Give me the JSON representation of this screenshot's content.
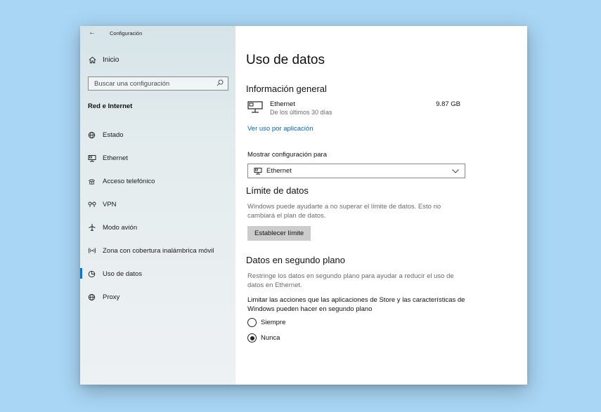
{
  "window": {
    "title": "Configuración"
  },
  "sidebar": {
    "home_label": "Inicio",
    "search_placeholder": "Buscar una configuración",
    "section_title": "Red e Internet",
    "items": [
      {
        "label": "Estado",
        "icon": "status-globe-icon"
      },
      {
        "label": "Ethernet",
        "icon": "ethernet-icon"
      },
      {
        "label": "Acceso telefónico",
        "icon": "dial-up-icon"
      },
      {
        "label": "VPN",
        "icon": "vpn-icon"
      },
      {
        "label": "Modo avión",
        "icon": "airplane-icon"
      },
      {
        "label": "Zona con cobertura inalámbrica móvil",
        "icon": "hotspot-icon"
      },
      {
        "label": "Uso de datos",
        "icon": "data-usage-icon",
        "active": true
      },
      {
        "label": "Proxy",
        "icon": "globe-icon"
      }
    ]
  },
  "main": {
    "title": "Uso de datos",
    "overview": {
      "heading": "Información general",
      "connection_name": "Ethernet",
      "period": "De los últimos 30 días",
      "usage": "9.87 GB",
      "link": "Ver uso por aplicación"
    },
    "show_settings_label": "Mostrar configuración para",
    "dropdown_value": "Ethernet",
    "data_limit": {
      "heading": "Límite de datos",
      "description": "Windows puede ayudarte a no superar el límite de datos. Esto no cambiará el plan de datos.",
      "button": "Establecer límite"
    },
    "background_data": {
      "heading": "Datos en segundo plano",
      "description": "Restringe los datos en segundo plano para ayudar a reducir el uso de datos en Ethernet.",
      "limit_text": "Limitar las acciones que las aplicaciones de Store y las características de Windows pueden hacer en segundo plano",
      "options": [
        {
          "label": "Siempre",
          "selected": false
        },
        {
          "label": "Nunca",
          "selected": true
        }
      ]
    }
  },
  "colors": {
    "accent": "#0078d7",
    "link": "#0067b8",
    "background": "#a9d6f5"
  }
}
